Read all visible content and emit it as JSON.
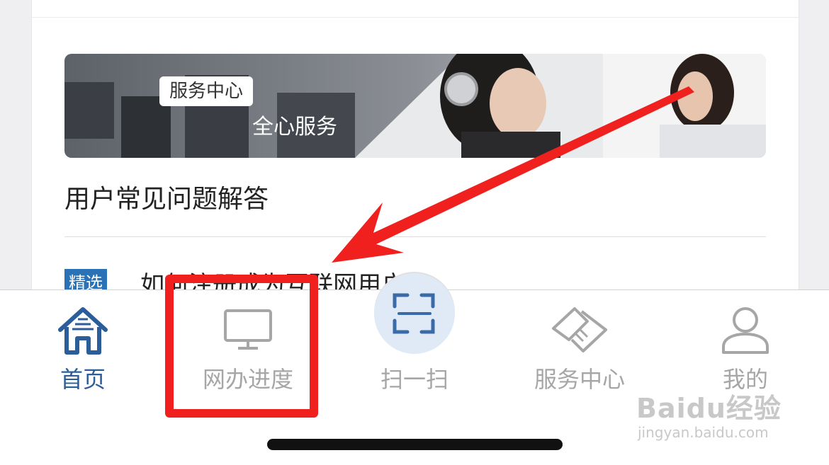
{
  "banner": {
    "tag": "服务中心",
    "subtitle": "全心服务"
  },
  "faq": {
    "title": "用户常见问题解答",
    "item": {
      "badge": "精选",
      "text": "如何注册成为互联网用户?"
    }
  },
  "tabbar": {
    "active_index": 0,
    "tabs": [
      {
        "label": "首页",
        "icon": "home-icon"
      },
      {
        "label": "网办进度",
        "icon": "monitor-icon"
      },
      {
        "label": "扫一扫",
        "icon": "scan-icon"
      },
      {
        "label": "服务中心",
        "icon": "handshake-icon"
      },
      {
        "label": "我的",
        "icon": "user-icon"
      }
    ]
  },
  "watermark": {
    "brand": "Baidu经验",
    "url": "jingyan.baidu.com"
  },
  "colors": {
    "accent": "#2a5d9a",
    "annotation_red": "#f0201e",
    "inactive": "#a6a6a6"
  }
}
